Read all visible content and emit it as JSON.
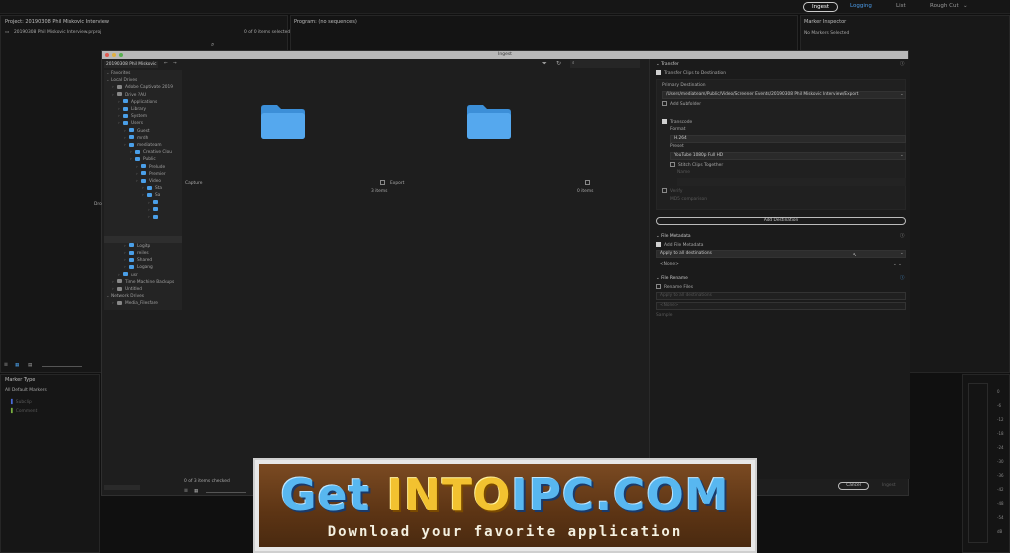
{
  "workspace_tabs": [
    {
      "label": "Ingest",
      "state": "active"
    },
    {
      "label": "Logging",
      "state": "blue"
    },
    {
      "label": "List",
      "state": "normal"
    },
    {
      "label": "Rough Cut",
      "state": "normal"
    }
  ],
  "project_panel": {
    "title": "Project: 20190308 Phil Miskovic Interview",
    "file": "20190308 Phil Miskovic Interview.prproj",
    "selected": "0 of 0 items selected"
  },
  "program_panel": {
    "title": "Program: (no sequences)"
  },
  "marker_inspector": {
    "title": "Marker Inspector",
    "empty": "No Markers Selected"
  },
  "marker_type": {
    "title": "Marker Type",
    "all": "All Default Markers",
    "items": [
      "Subclip",
      "Comment"
    ]
  },
  "dialog": {
    "title": "Ingest",
    "breadcrumb": "20190308 Phil Miskovic",
    "tree": [
      {
        "label": "Favorites",
        "type": "group",
        "indent": 0
      },
      {
        "label": "Local Drives",
        "type": "group",
        "indent": 0
      },
      {
        "label": "Adobe Captivate 2019",
        "type": "drive",
        "indent": 1
      },
      {
        "label": "Drive ?AU",
        "type": "drive",
        "indent": 1
      },
      {
        "label": "Applications",
        "type": "folder",
        "indent": 2
      },
      {
        "label": "Library",
        "type": "folder",
        "indent": 2
      },
      {
        "label": "System",
        "type": "folder",
        "indent": 2
      },
      {
        "label": "Users",
        "type": "folder",
        "indent": 2
      },
      {
        "label": "Guest",
        "type": "folder",
        "indent": 3
      },
      {
        "label": "mrdh",
        "type": "folder",
        "indent": 3
      },
      {
        "label": "mediateam",
        "type": "folder",
        "indent": 3
      },
      {
        "label": "Creative Clou",
        "type": "folder",
        "indent": 4
      },
      {
        "label": "Public",
        "type": "folder",
        "indent": 4
      },
      {
        "label": "Prelude",
        "type": "folder",
        "indent": 5
      },
      {
        "label": "Premier",
        "type": "folder",
        "indent": 5
      },
      {
        "label": "Video",
        "type": "folder",
        "indent": 5
      },
      {
        "label": "Sta",
        "type": "folder",
        "indent": 6
      },
      {
        "label": "Sa",
        "type": "folder",
        "indent": 6
      },
      {
        "label": "",
        "type": "folder",
        "indent": 7
      },
      {
        "label": "",
        "type": "folder",
        "indent": 7
      },
      {
        "label": "",
        "type": "folder",
        "indent": 7
      },
      {
        "label": "",
        "type": "blank",
        "indent": 0
      },
      {
        "label": "",
        "type": "blank",
        "indent": 0
      },
      {
        "label": "",
        "type": "blank",
        "indent": 0
      },
      {
        "label": "Logitp",
        "type": "folder",
        "indent": 3
      },
      {
        "label": "reiles",
        "type": "folder",
        "indent": 3
      },
      {
        "label": "Shared",
        "type": "folder",
        "indent": 3
      },
      {
        "label": "Logang",
        "type": "folder",
        "indent": 3
      },
      {
        "label": "usr",
        "type": "folder",
        "indent": 2
      },
      {
        "label": "Time Machine Backups",
        "type": "drive",
        "indent": 1
      },
      {
        "label": "Untitled",
        "type": "drive",
        "indent": 1
      },
      {
        "label": "Network Drives",
        "type": "group",
        "indent": 0
      },
      {
        "label": "Media_Filesfare",
        "type": "drive",
        "indent": 1
      }
    ],
    "folders": [
      {
        "name": "Capture",
        "count": "3 items"
      },
      {
        "name": "Export",
        "count": "0 items"
      }
    ],
    "items_checked": "0 of 3 items checked",
    "cancel_label": "Cancel",
    "ingest_label": "Ingest",
    "side_label": "Dro"
  },
  "settings": {
    "transfer_header": "Transfer",
    "transfer_clips": "Transfer Clips to Destination",
    "primary_dest": "Primary Destination",
    "dest_path": "/Users/mediateam/Public/Video/Screener Events/20190308 Phil Miskovic Interview/Export",
    "add_subfolder": "Add Subfolder",
    "transcode": "Transcode",
    "format_label": "Format",
    "format_value": "H.264",
    "preset_label": "Preset",
    "preset_value": "YouTube 1080p Full HD",
    "stitch": "Stitch Clips Together",
    "name_label": "Name",
    "verify": "Verify",
    "md5": "MD5 comparison",
    "add_destination": "Add Destination",
    "metadata_header": "File Metadata",
    "add_metadata": "Add File Metadata",
    "apply_all": "Apply to all destinations",
    "none": "<None>",
    "rename_header": "File Rename",
    "rename_files": "Rename Files",
    "rename_apply": "Apply to all destinations",
    "rename_preset": "<None>",
    "sample": "Sample"
  },
  "meter_ticks": [
    "0",
    "-6",
    "-12",
    "-18",
    "-24",
    "-30",
    "-36",
    "-42",
    "-48",
    "-54",
    "dB"
  ],
  "banner": {
    "logo_left": "Get",
    "logo_mid": "INTO",
    "logo_right": "IPC",
    "logo_com": ".COM",
    "tagline": "Download your favorite application"
  }
}
